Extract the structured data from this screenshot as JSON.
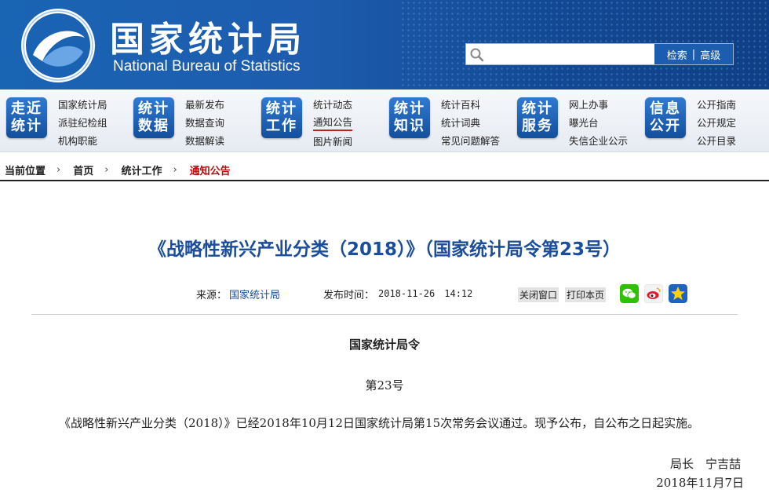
{
  "header": {
    "title_cn": "国家统计局",
    "title_en": "National Bureau of Statistics",
    "search": {
      "placeholder": "",
      "search_label": "检索",
      "advanced_label": "高级",
      "separator": "|"
    }
  },
  "nav": [
    {
      "badge_line1": "走近",
      "badge_line2": "统计",
      "links": [
        "国家统计局",
        "派驻纪检组",
        "机构职能"
      ]
    },
    {
      "badge_line1": "统计",
      "badge_line2": "数据",
      "links": [
        "最新发布",
        "数据查询",
        "数据解读"
      ]
    },
    {
      "badge_line1": "统计",
      "badge_line2": "工作",
      "links": [
        "统计动态",
        "通知公告",
        "图片新闻"
      ]
    },
    {
      "badge_line1": "统计",
      "badge_line2": "知识",
      "links": [
        "统计百科",
        "统计词典",
        "常见问题解答"
      ]
    },
    {
      "badge_line1": "统计",
      "badge_line2": "服务",
      "links": [
        "网上办事",
        "曝光台",
        "失信企业公示"
      ]
    },
    {
      "badge_line1": "信息",
      "badge_line2": "公开",
      "links": [
        "公开指南",
        "公开规定",
        "公开目录"
      ]
    }
  ],
  "breadcrumb": {
    "label": "当前位置",
    "items": [
      "首页",
      "统计工作",
      "通知公告"
    ],
    "separator": "›"
  },
  "article": {
    "title": "《战略性新兴产业分类（2018）》（国家统计局令第23号）",
    "source_label": "来源：",
    "source": "国家统计局",
    "time_label": "发布时间：",
    "time": "2018-11-26　14:12",
    "close_label": "关闭窗口",
    "print_label": "打印本页",
    "heading": "国家统计局令",
    "number": "第23号",
    "body": "《战略性新兴产业分类（2018）》已经2018年10月12日国家统计局第15次常务会议通过。现予公布，自公布之日起实施。",
    "signature": "局长　宁吉喆",
    "date": "2018年11月7日"
  },
  "colors": {
    "header_blue": "#1d5cae",
    "title_blue": "#1a4d9c",
    "breadcrumb_current": "#b40f0f"
  },
  "icons": [
    "search-icon",
    "wechat-icon",
    "weibo-icon",
    "favorite-star-icon",
    "logo-emblem-icon"
  ]
}
